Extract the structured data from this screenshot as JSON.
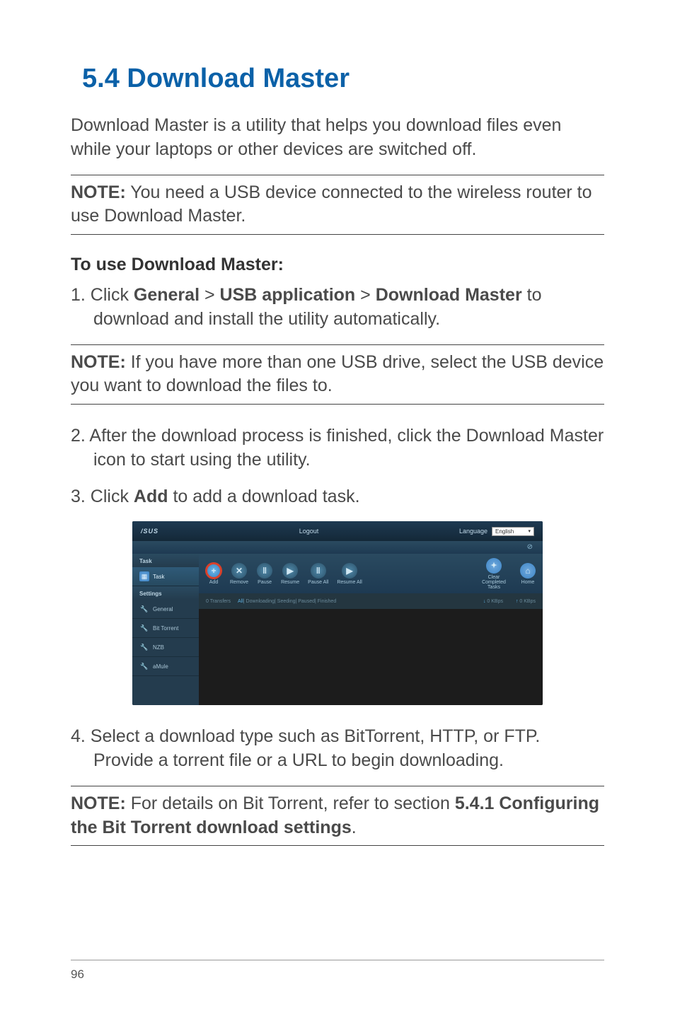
{
  "section_title": "5.4   Download Master",
  "intro": "Download Master is a utility that helps you download files even while your laptops or other devices are switched off.",
  "note1": {
    "label": "NOTE:",
    "text": " You need a USB device connected to the wireless router to use Download Master."
  },
  "how_to_title": "To use Download Master:",
  "step1": {
    "num": "1.  ",
    "pre": "Click ",
    "b1": "General",
    "sep1": " > ",
    "b2": "USB application",
    "sep2": " > ",
    "b3": "Download Master",
    "post": " to download and install the utility automatically."
  },
  "note2": {
    "label": "NOTE:  ",
    "text": "If you have more than one USB drive, select the USB device you want to download the files to."
  },
  "step2": {
    "num": "2.  ",
    "text": "After the download process is finished, click the Download Master icon to start using the utility."
  },
  "step3": {
    "num": "3.  ",
    "pre": "Click ",
    "b1": "Add",
    "post": " to add a download task."
  },
  "step4": {
    "num": "4.  ",
    "text": "Select a download type such as BitTorrent, HTTP, or FTP. Provide a torrent file or a URL to begin downloading."
  },
  "note3": {
    "label": "NOTE:  ",
    "pre": "For details on Bit Torrent, refer to section ",
    "b1": "5.4.1 Configuring the Bit Torrent download settings",
    "post": "."
  },
  "page_number": "96",
  "ss": {
    "logo": "/SUS",
    "logout": "Logout",
    "lang_label": "Language",
    "lang_value": "English",
    "help": "⊘",
    "sidebar": {
      "sec1": "Task",
      "task": "Task",
      "sec2": "Settings",
      "general": "General",
      "bt": "Bit Torrent",
      "nzb": "NZB",
      "amule": "aMule"
    },
    "toolbar": {
      "add": "Add",
      "remove": "Remove",
      "pause": "Pause",
      "resume": "Resume",
      "pause_all": "Pause All",
      "resume_all": "Resume All",
      "clear": "Clear Completed Tasks",
      "home": "Home"
    },
    "filters": {
      "transfers": "0 Transfers",
      "all": "All",
      "rest": "| Downloading| Seeding| Paused| Finished",
      "down": "0 KBps",
      "up": "0 KBps"
    }
  }
}
